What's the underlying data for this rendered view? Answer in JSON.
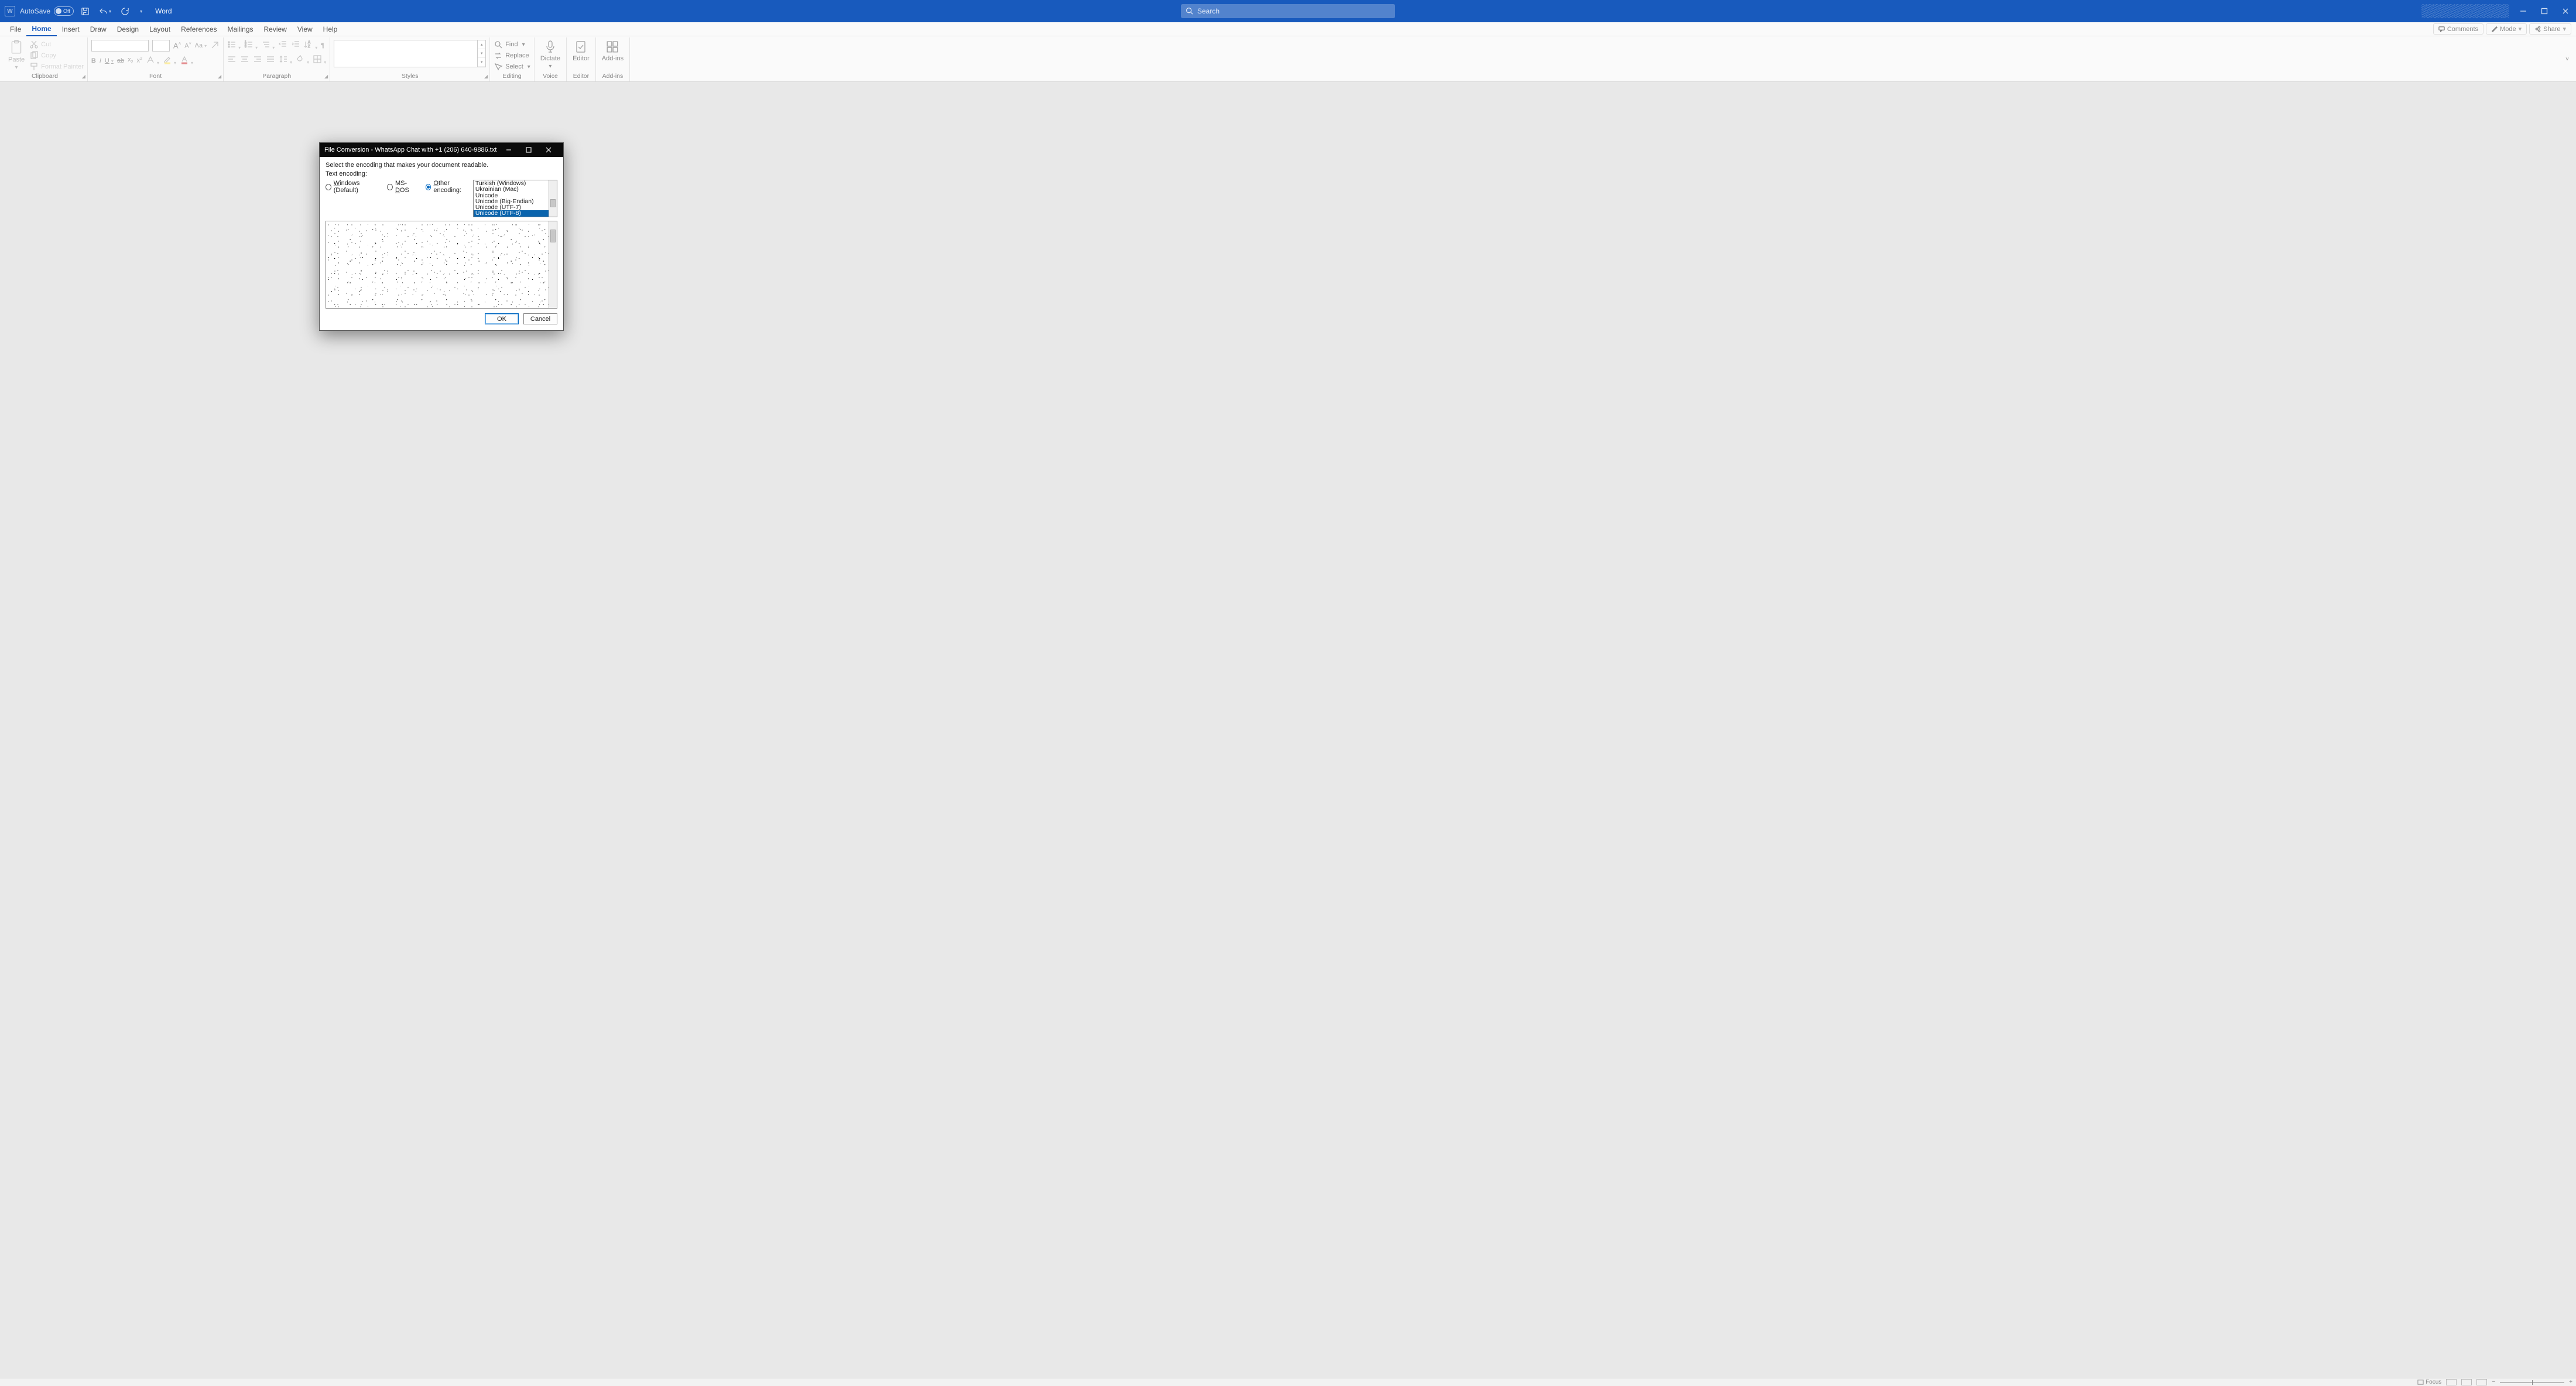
{
  "titlebar": {
    "autosave_label": "AutoSave",
    "autosave_state": "Off",
    "doc_title": "Word",
    "search_placeholder": "Search"
  },
  "tabs": {
    "items": [
      "File",
      "Home",
      "Insert",
      "Draw",
      "Design",
      "Layout",
      "References",
      "Mailings",
      "Review",
      "View",
      "Help"
    ],
    "active": "Home",
    "comments": "Comments",
    "mode": "Mode",
    "share": "Share"
  },
  "ribbon": {
    "paste": "Paste",
    "cut": "Cut",
    "copy": "Copy",
    "format_painter": "Format Painter",
    "clipboard": "Clipboard",
    "font": "Font",
    "paragraph": "Paragraph",
    "styles": "Styles",
    "editing": "Editing",
    "find": "Find",
    "replace": "Replace",
    "select": "Select",
    "dictate": "Dictate",
    "voice": "Voice",
    "editor": "Editor",
    "addins": "Add-ins"
  },
  "status": {
    "focus": "Focus"
  },
  "dialog": {
    "title": "File Conversion - WhatsApp Chat with +1 (206) 640-9886.txt",
    "instruction": "Select the encoding that makes your document readable.",
    "text_encoding_label": "Text encoding:",
    "radio_windows_pre": "W",
    "radio_windows_post": "indows (Default)",
    "radio_msdos_pre": "MS-",
    "radio_msdos_mid": "D",
    "radio_msdos_post": "OS",
    "radio_other_pre": "O",
    "radio_other_post": "ther encoding:",
    "encodings": [
      "Turkish (Windows)",
      "Ukrainian (Mac)",
      "Unicode",
      "Unicode (Big-Endian)",
      "Unicode (UTF-7)",
      "Unicode (UTF-8)"
    ],
    "selected_encoding": "Unicode (UTF-8)",
    "ok": "OK",
    "cancel": "Cancel"
  }
}
